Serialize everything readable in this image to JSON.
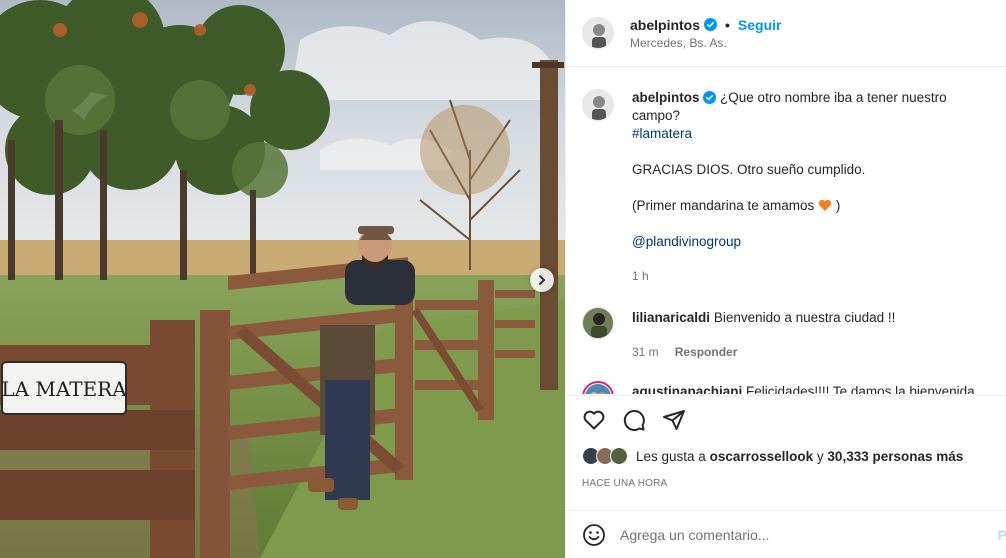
{
  "post": {
    "author": "abelpintos",
    "follow_label": "Seguir",
    "separator": "•",
    "location": "Mercedes, Bs. As.",
    "sign_text": "LA MATERA"
  },
  "caption": {
    "username": "abelpintos",
    "line1": "¿Que otro nombre iba a tener nuestro campo?",
    "hashtag": "#lamatera",
    "para2": "GRACIAS DIOS. Otro sueño cumplido.",
    "para3_text": "(Primer mandarina te amamos",
    "para3_close": ")",
    "mention": "@plandivinogroup",
    "time": "1 h"
  },
  "comments": [
    {
      "username": "lilianaricaldi",
      "text": "Bienvenido a nuestra ciudad !!",
      "time": "31 m",
      "reply_label": "Responder"
    },
    {
      "username": "agustinapachiani",
      "text": "Felicidades!!!! Te damos la bienvenida los mercedinos!! Orgullosos de que elijas nuestro lugar"
    }
  ],
  "likes": {
    "prefix": "Les gusta a",
    "user": "oscarrossellook",
    "connector": "y",
    "count": "30,333 personas más"
  },
  "post_time": "HACE UNA HORA",
  "comment_input": {
    "placeholder": "Agrega un comentario...",
    "publish_label": "P"
  },
  "icons": {
    "verified": "verified-badge-icon",
    "like": "heart-icon",
    "comment": "comment-bubble-icon",
    "share": "paper-plane-icon",
    "emoji": "emoji-smile-icon",
    "carousel_next": "chevron-right-icon",
    "caption_emoji": "orange-heart-emoji"
  },
  "colors": {
    "link_blue": "#0095f6",
    "hashtag_blue": "#00376b",
    "verified_blue": "#0095f6",
    "orange_heart": "#f4801f"
  }
}
